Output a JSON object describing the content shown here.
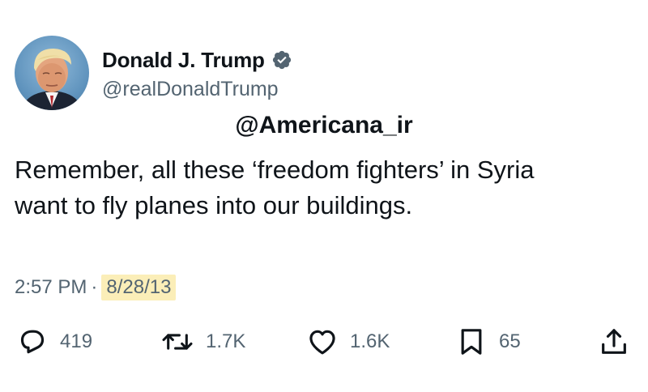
{
  "author": {
    "display_name": "Donald J. Trump",
    "handle": "@realDonaldTrump",
    "verified": true,
    "verified_color": "#536471"
  },
  "watermark": "@Americana_ir",
  "tweet": {
    "lines": [
      "Remember, all these ‘freedom fighters’ in Syria",
      "want to fly planes into our buildings."
    ]
  },
  "meta": {
    "time": "2:57 PM",
    "separator": "·",
    "date": "8/28/13",
    "date_highlight_color": "#fbeeb8"
  },
  "actions": {
    "replies": "419",
    "retweets": "1.7K",
    "likes": "1.6K",
    "bookmarks": "65"
  },
  "colors": {
    "text": "#0f1419",
    "secondary": "#536471",
    "background": "#ffffff"
  }
}
